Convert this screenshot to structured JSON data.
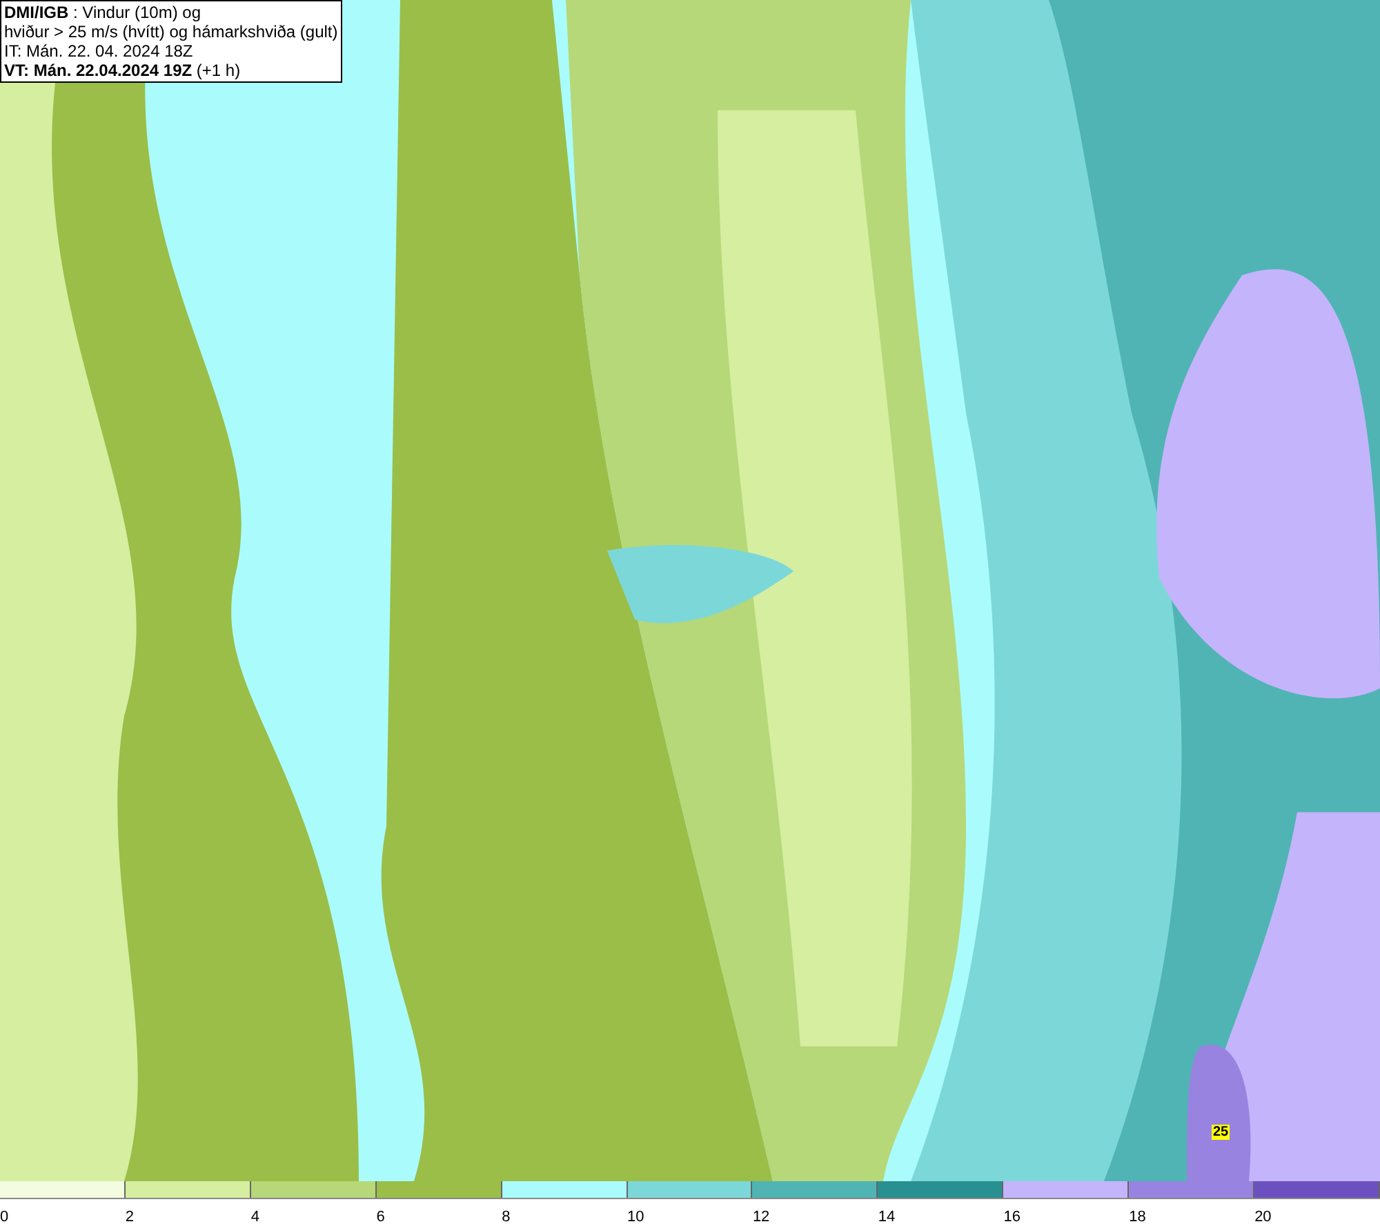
{
  "header": {
    "lines": [
      "**DMI/IGB** : Vindur (10m) og",
      "hviður > 25 m/s (hvítt) og hámarkshviða (gult)",
      "IT: Mán. 22. 04. 2024 18Z",
      "**VT: Mán. 22.04.2024 19Z** (+1 h)"
    ]
  },
  "map": {
    "gust_label": "25"
  },
  "legend": [
    {
      "label": "0",
      "color": "#f3fbe0"
    },
    {
      "label": "2",
      "color": "#d6eea0"
    },
    {
      "label": "4",
      "color": "#b6d878"
    },
    {
      "label": "6",
      "color": "#9abe48"
    },
    {
      "label": "8",
      "color": "#aafcfc"
    },
    {
      "label": "10",
      "color": "#7cd8d8"
    },
    {
      "label": "12",
      "color": "#50b4b4"
    },
    {
      "label": "14",
      "color": "#289090"
    },
    {
      "label": "16",
      "color": "#c4b4fc"
    },
    {
      "label": "18",
      "color": "#9884e0"
    },
    {
      "label": "20",
      "color": "#6c50c0"
    }
  ]
}
